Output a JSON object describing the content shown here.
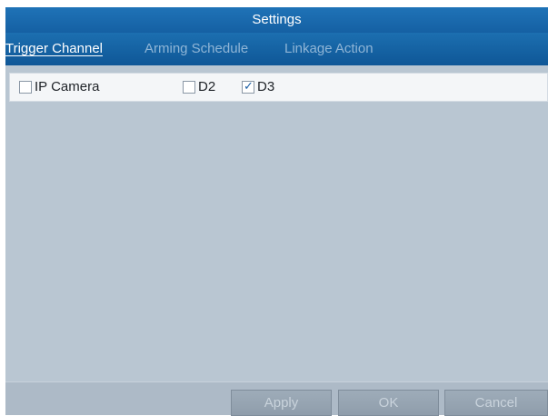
{
  "window": {
    "title": "Settings"
  },
  "tabs": [
    {
      "label": "Trigger Channel",
      "active": true
    },
    {
      "label": "Arming Schedule",
      "active": false
    },
    {
      "label": "Linkage Action",
      "active": false
    }
  ],
  "channels": [
    {
      "label": "IP Camera",
      "checked": false
    },
    {
      "label": "D2",
      "checked": false
    },
    {
      "label": "D3",
      "checked": true
    }
  ],
  "footer": {
    "apply_label": "Apply",
    "ok_label": "OK",
    "cancel_label": "Cancel"
  },
  "colors": {
    "title_bar": "#1f73b7",
    "panel_bg": "#b9c6d2",
    "active_tab": "#ffffff",
    "inactive_tab": "#8fb5d6"
  }
}
